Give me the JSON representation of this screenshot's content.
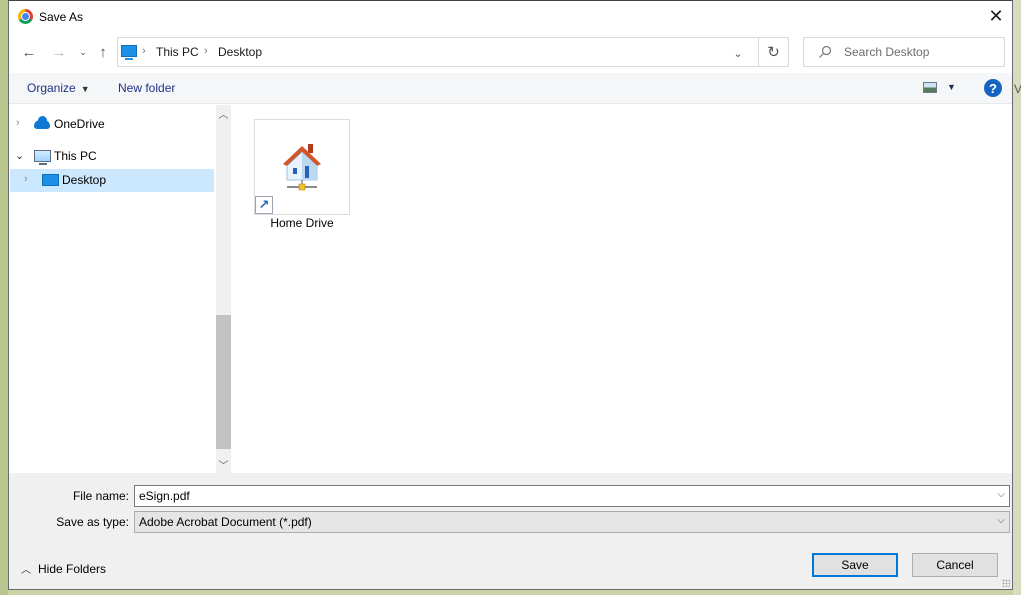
{
  "window": {
    "title": "Save As",
    "app_icon": "chrome-icon",
    "close_icon": "close-icon"
  },
  "navigation": {
    "back_icon": "arrow-left-icon",
    "forward_icon": "arrow-right-icon",
    "recent_icon": "chevron-down-icon",
    "up_icon": "arrow-up-icon",
    "breadcrumb": [
      "This PC",
      "Desktop"
    ],
    "refresh_icon": "refresh-icon",
    "search_placeholder": "Search Desktop"
  },
  "toolbar": {
    "organize_label": "Organize",
    "new_folder_label": "New folder",
    "view_icon": "view-options-icon",
    "help_label": "?"
  },
  "nav_pane": {
    "items": [
      {
        "label": "OneDrive",
        "icon": "onedrive-icon",
        "expanded": false,
        "selected": false
      },
      {
        "label": "This PC",
        "icon": "computer-icon",
        "expanded": true,
        "selected": false
      },
      {
        "label": "Desktop",
        "icon": "desktop-icon",
        "expanded": false,
        "selected": true
      }
    ]
  },
  "content": {
    "items": [
      {
        "label": "Home Drive",
        "icon": "network-home-icon",
        "shortcut": true
      }
    ]
  },
  "footer": {
    "file_name_label": "File name:",
    "file_name_value": "eSign.pdf",
    "save_type_label": "Save as type:",
    "save_type_value": "Adobe Acrobat Document (*.pdf)",
    "hide_folders_label": "Hide Folders",
    "save_label": "Save",
    "cancel_label": "Cancel"
  },
  "colors": {
    "accent": "#0078d7",
    "selection": "#cce8ff",
    "link_text": "#1e3287"
  }
}
